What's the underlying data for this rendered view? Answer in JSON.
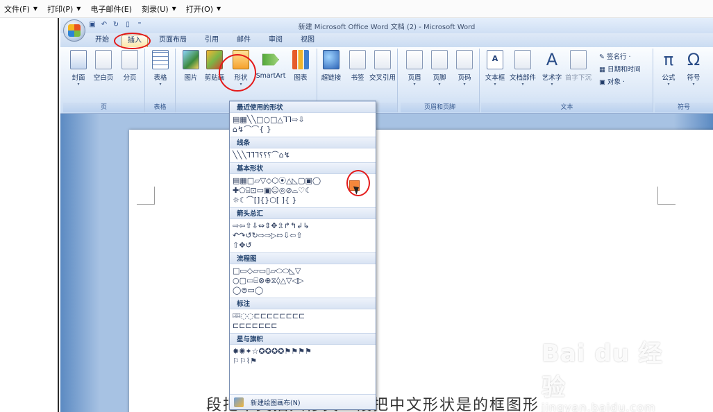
{
  "topbar": {
    "menus": [
      {
        "label": "文件(F)",
        "caret": "▼"
      },
      {
        "label": "打印(P)",
        "caret": "▼"
      },
      {
        "label": "电子邮件(E)",
        "caret": ""
      },
      {
        "label": "刻录(U)",
        "caret": "▼"
      },
      {
        "label": "打开(O)",
        "caret": "▼"
      }
    ]
  },
  "word": {
    "title": "新建 Microsoft Office Word 文档 (2) - Microsoft Word",
    "tabs": [
      "开始",
      "插入",
      "页面布局",
      "引用",
      "邮件",
      "审阅",
      "视图"
    ],
    "active_tab": "插入",
    "groups": {
      "page": {
        "label": "页",
        "buttons": [
          "封面",
          "空白页",
          "分页"
        ]
      },
      "table": {
        "label": "表格",
        "buttons": [
          "表格"
        ]
      },
      "illustrations": {
        "buttons": [
          "图片",
          "剪贴画",
          "形状",
          "SmartArt",
          "图表"
        ]
      },
      "links": {
        "buttons": [
          "超链接",
          "书签",
          "交叉引用"
        ]
      },
      "header_footer": {
        "label": "页眉和页脚",
        "buttons": [
          "页眉",
          "页脚",
          "页码"
        ]
      },
      "text": {
        "label": "文本",
        "buttons": [
          "文本框",
          "文档部件",
          "艺术字",
          "首字下沉"
        ],
        "small": [
          "签名行 ·",
          "日期和时间",
          "对象 ·"
        ]
      },
      "symbols": {
        "label": "符号",
        "buttons": [
          "公式",
          "符号"
        ]
      }
    },
    "body_text": "段把中文插入修关一段把中文形状是的框图形"
  },
  "gallery": {
    "sections": [
      {
        "title": "最近使用的形状",
        "rows": [
          "▤▦╲╲□○□△⅂⅂⇨⇩",
          "⌂↯⌒⌒{ }"
        ]
      },
      {
        "title": "线条",
        "rows": [
          "╲╲╲⅂⅂⅂⸮⸮⸮⌒⌂↯"
        ]
      },
      {
        "title": "基本形状",
        "rows": [
          "▤▦□▱▽◇⬡⦿△◺▢▣◯",
          "✚⬠⌸⊡▭▣☺◎⊘⌓♡☾",
          "☼☾⌒[]{}⬡[ ]{ }"
        ]
      },
      {
        "title": "箭头总汇",
        "rows": [
          "⇨⇦⇧⇩⇔⇕✥⇫↱↰↲↳",
          "↶↷↺↻⇨⇨▷⇰⇩⇦⇧",
          "⇧✥↺"
        ]
      },
      {
        "title": "流程图",
        "rows": [
          "□▭◇▱▭▯▱⬭⬭◺▽",
          "○▢▭⌸⊗⊕⧖◊△▽◁▷",
          "◯⊜▭◯"
        ]
      },
      {
        "title": "标注",
        "rows": [
          "⌑⌑◌◌⊏⊏⊏⊏⊏⊏⊏⊏",
          "⊏⊏⊏⊏⊏⊏⊏"
        ]
      },
      {
        "title": "星与旗帜",
        "rows": [
          "✸✺✦☆✪✪✪✪⚑⚑⚑⚑",
          "⚐⚐⌇⚑"
        ]
      }
    ],
    "footer": "新建绘图画布(N)"
  },
  "watermark": {
    "main": "Bai du 经验",
    "sub": "jingyan.baidu.com"
  },
  "colors": {
    "ring": "#e41a1a",
    "ribbon": "#dce8f7",
    "frame": "#5f8fc6"
  }
}
